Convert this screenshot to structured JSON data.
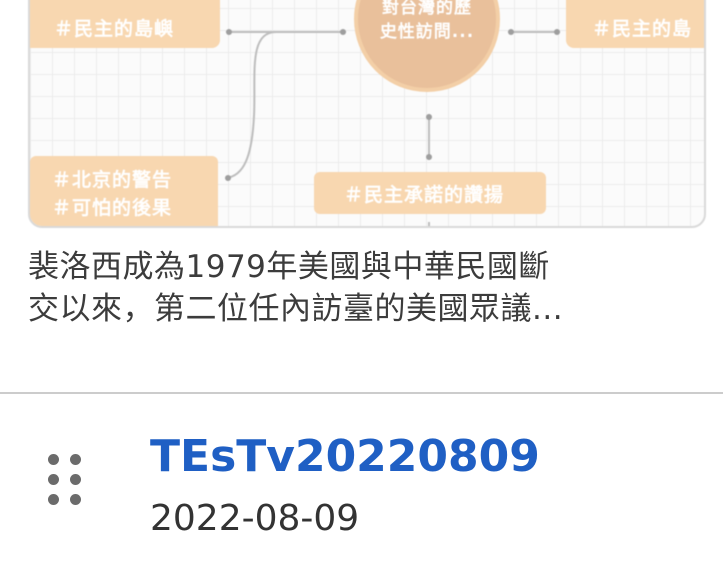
{
  "thumbnail": {
    "node_top_left": "＃民主的島嶼",
    "node_top_right": "＃民主的島",
    "node_center_line1": "對台灣的歷",
    "node_center_line2": "史性訪問...",
    "node_bottom_left_line1": "＃北京的警告",
    "node_bottom_left_line2": "＃可怕的後果",
    "node_bottom_middle": "＃民主承諾的讚揚",
    "colors": {
      "node": "#f8d7b0",
      "circle": "#e9c09b",
      "connector": "#bdbdbd"
    }
  },
  "caption": {
    "line1": "裴洛西成為1979年美國與中華民國斷",
    "line2": "交以來，第二位任內訪臺的美國眾議..."
  },
  "item": {
    "drag_icon": "drag-handle-icon",
    "title": "TEsTv20220809",
    "date": "2022-08-09",
    "colors": {
      "title": "#1f5fc4"
    }
  }
}
